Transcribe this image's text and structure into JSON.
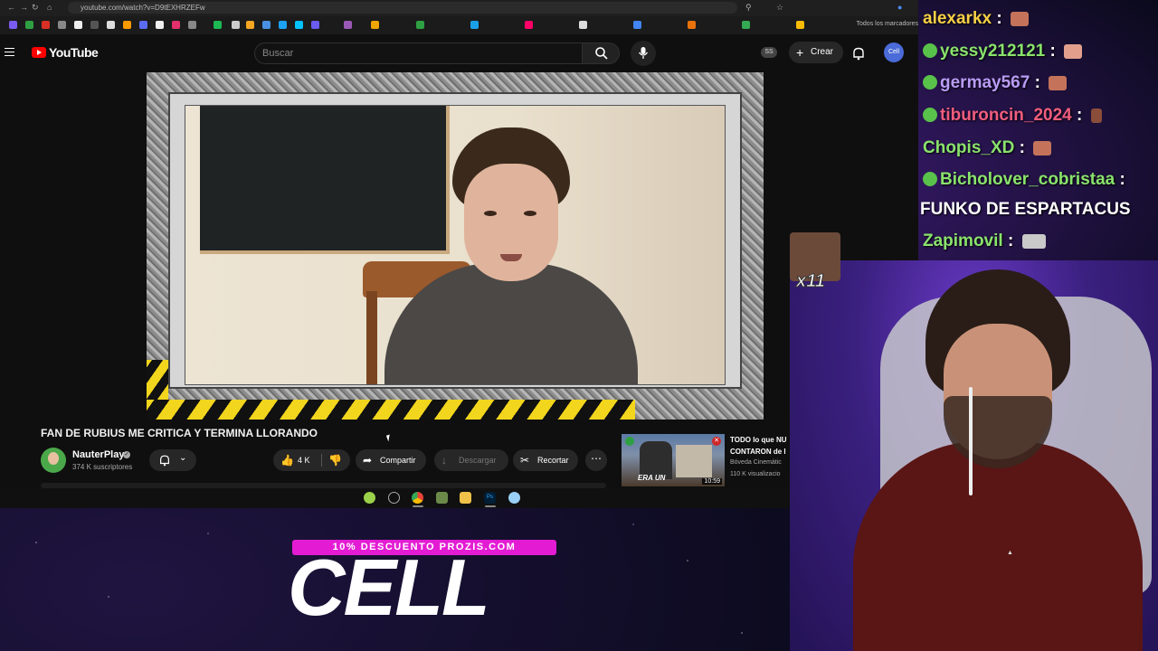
{
  "browser": {
    "url": "youtube.com/watch?v=D9tEXHRZEFw",
    "bookmarks_label": "Todos los marcadores"
  },
  "youtube": {
    "logo": "YouTube",
    "search_placeholder": "Buscar",
    "ss_badge": "SS",
    "create_label": "Crear",
    "account_initials": "Cell"
  },
  "video": {
    "title": "FAN DE RUBIUS ME CRITICA Y TERMINA LLORANDO",
    "channel": "NauterPlay",
    "subscribers": "374 K suscriptores",
    "likes": "4 K",
    "share_label": "Compartir",
    "download_label": "Descargar",
    "clip_label": "Recortar"
  },
  "related": {
    "title": "TODO lo que NU CONTARON de l",
    "thumb_text": "ERA UN",
    "channel": "Bóveda Cinemátic",
    "views": "110 K visualizacio",
    "duration": "10:59"
  },
  "chat": {
    "messages": [
      {
        "user": "alexarkx",
        "color": "#f7d046",
        "badge": false
      },
      {
        "user": "yessy212121",
        "color": "#8ae36c",
        "badge": true
      },
      {
        "user": "germay567",
        "color": "#b99cf5",
        "badge": true
      },
      {
        "user": "tiburoncin_2024",
        "color": "#f05d7d",
        "badge": true
      },
      {
        "user": "Chopis_XD",
        "color": "#8ae36c",
        "badge": false
      },
      {
        "user": "Bicholover_cobristaa",
        "color": "#8ae36c",
        "badge": true
      },
      {
        "user": "Zapimovil",
        "color": "#8ae36c",
        "badge": false
      }
    ],
    "funko_text": "FUNKO DE ESPARTACUS",
    "multiplier": "x11"
  },
  "overlay": {
    "promo": "10% DESCUENTO PROZIS.COM",
    "brand": "CELL"
  },
  "colors": {
    "yt_red": "#ff0000",
    "promo_magenta": "#e31cd4",
    "hazard_yellow": "#f2d51d"
  }
}
